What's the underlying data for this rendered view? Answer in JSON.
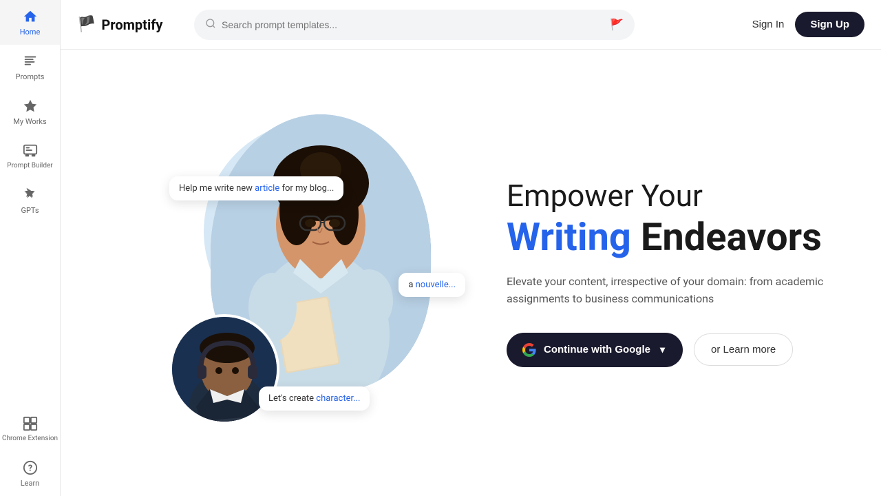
{
  "app": {
    "name": "Promptify",
    "logo_icon": "🏴"
  },
  "topbar": {
    "search_placeholder": "Search prompt templates...",
    "signin_label": "Sign In",
    "signup_label": "Sign Up"
  },
  "sidebar": {
    "items": [
      {
        "id": "home",
        "label": "Home",
        "icon": "house",
        "active": true
      },
      {
        "id": "prompts",
        "label": "Prompts",
        "icon": "list"
      },
      {
        "id": "my-works",
        "label": "My Works",
        "icon": "star"
      },
      {
        "id": "prompt-builder",
        "label": "Prompt Builder",
        "icon": "layers"
      },
      {
        "id": "gpts",
        "label": "GPTs",
        "icon": "bolt"
      },
      {
        "id": "chrome-extension",
        "label": "Chrome Extension",
        "icon": "puzzle"
      },
      {
        "id": "learn",
        "label": "Learn",
        "icon": "question"
      }
    ]
  },
  "hero": {
    "line1": "Empower Your",
    "line2_blue": "Writing",
    "line2_dark": "Endeavors",
    "description": "Elevate your content, irrespective of your domain: from academic assignments to business communications",
    "btn_google": "Continue with Google",
    "btn_learn_more": "or Learn more",
    "bubble1": "Help me write new ",
    "bubble1_link": "article",
    "bubble1_end": " for my blog...",
    "bubble2_pre": "a ",
    "bubble2_link": "nouvelle...",
    "bubble3": "Let's create ",
    "bubble3_link": "character..."
  }
}
